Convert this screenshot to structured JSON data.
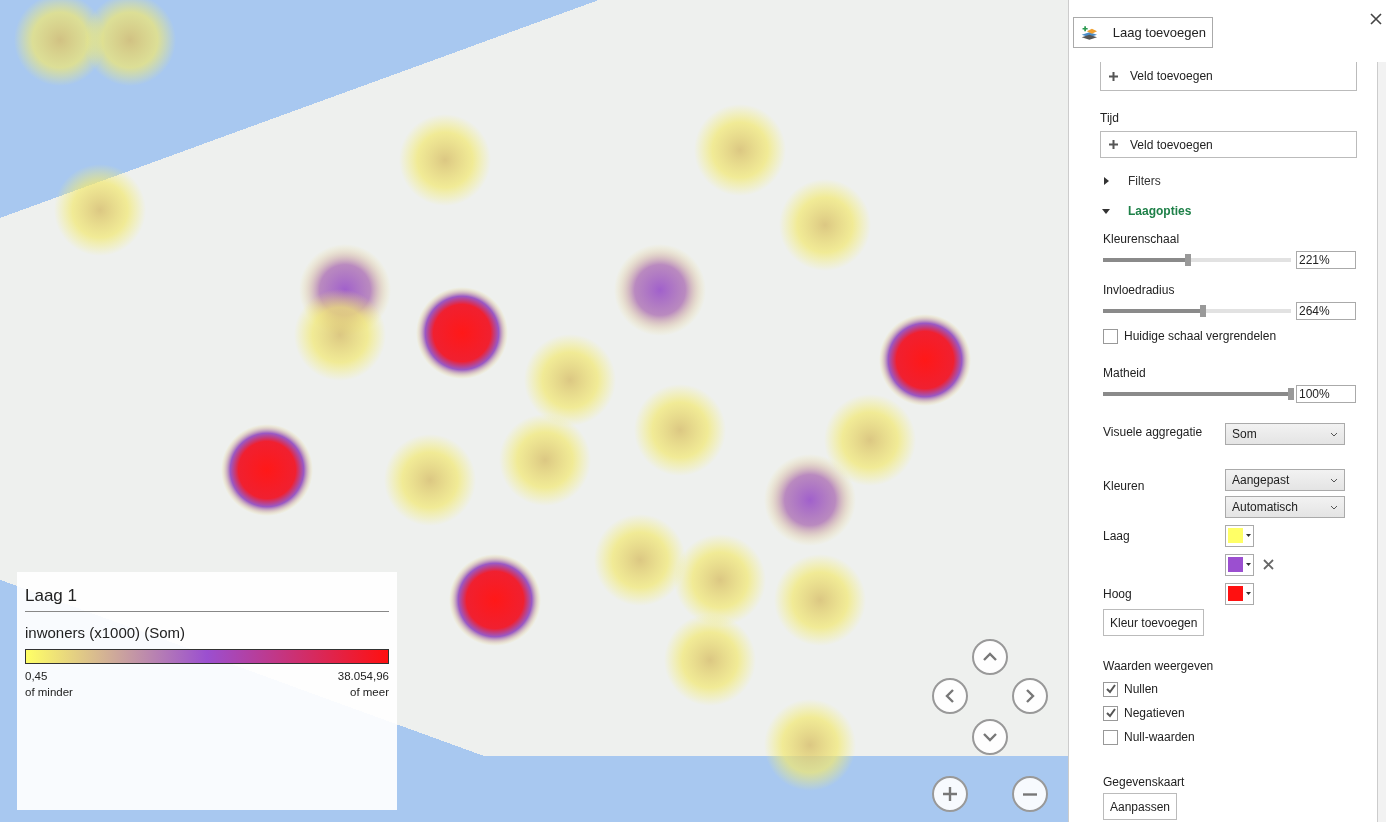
{
  "legend": {
    "title": "Laag 1",
    "measure": "inwoners (x1000) (Som)",
    "min_value": "0,45",
    "min_note": "of minder",
    "max_value": "38.054,96",
    "max_note": "of meer"
  },
  "panel": {
    "add_layer": "Laag toevoegen",
    "fields": [
      {
        "button": "Veld toevoegen"
      },
      {
        "label": "Tijd",
        "button": "Veld toevoegen"
      }
    ],
    "sections": [
      {
        "title": "Filters",
        "expanded": false
      },
      {
        "title": "Laagopties",
        "expanded": true
      }
    ],
    "sliders": [
      {
        "label": "Kleurenschaal",
        "level": 0.45,
        "value": "221%"
      },
      {
        "label": "Invloedradius",
        "level": 0.53,
        "value": "264%"
      },
      {
        "label": "Matheid",
        "level": 1,
        "value": "100%"
      }
    ],
    "lock_scale": {
      "label": "Huidige schaal vergrendelen",
      "checked": false
    },
    "aggregation": {
      "label": "Visuele aggregatie",
      "value": "Som"
    },
    "colors": {
      "label": "Kleuren",
      "mode": "Aangepast",
      "scheme": "Automatisch"
    },
    "stops": [
      {
        "label": "Laag",
        "color": "#ffff66",
        "removable": false
      },
      {
        "color": "#9b4fd0",
        "removable": true
      },
      {
        "label": "Hoog",
        "color": "#ff1010",
        "removable": false
      }
    ],
    "add_color": "Kleur toevoegen",
    "show_values": {
      "title": "Waarden weergeven",
      "options": [
        {
          "label": "Nullen",
          "checked": true
        },
        {
          "label": "Negatieven",
          "checked": true
        },
        {
          "label": "Null-waarden",
          "checked": false
        }
      ]
    },
    "data_card": {
      "title": "Gegevenskaart",
      "button": "Aanpassen"
    }
  }
}
